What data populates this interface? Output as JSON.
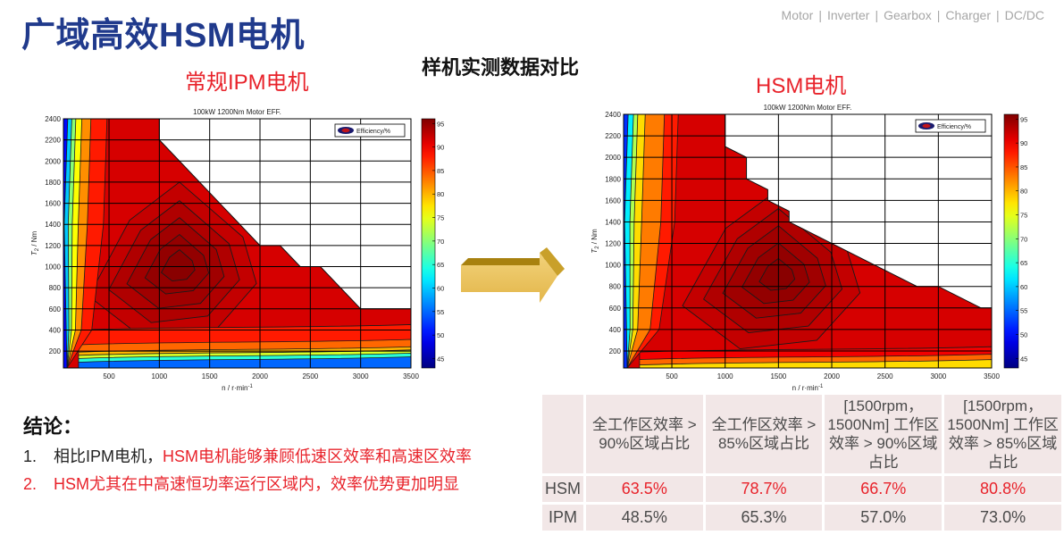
{
  "header": {
    "title": "广域高效HSM电机",
    "nav": [
      "Motor",
      "Inverter",
      "Gearbox",
      "Charger",
      "DC/DC"
    ],
    "nav_separator": "|"
  },
  "subtitle": "样机实测数据对比",
  "labels": {
    "ipm": "常规IPM电机",
    "hsm": "HSM电机"
  },
  "arrow_icon": "right-arrow-icon",
  "chart_data": [
    {
      "id": "ipm",
      "type": "heatmap",
      "title": "100kW 1200Nm Motor EFF.",
      "xlabel": "n / r·min",
      "xlabel_sup": "-1",
      "ylabel": "T",
      "ylabel_sub": "2",
      "ylabel_rest": " / Nm",
      "xlim": [
        47,
        3500
      ],
      "ylim": [
        40,
        2400
      ],
      "xticks": [
        500,
        1000,
        1500,
        2000,
        2500,
        3000,
        3500
      ],
      "yticks": [
        200,
        400,
        600,
        800,
        1000,
        1200,
        1400,
        1600,
        1800,
        2000,
        2200,
        2400
      ],
      "grid": true,
      "legend": {
        "label": "Efficiency/%",
        "position": "top-right"
      },
      "colorbar": {
        "range": [
          43,
          96
        ],
        "ticks": [
          45,
          50,
          55,
          60,
          65,
          70,
          75,
          80,
          85,
          90,
          95
        ],
        "colormap": "jet"
      },
      "torque_envelope": [
        [
          47,
          2400
        ],
        [
          1000,
          2400
        ],
        [
          1000,
          2200
        ],
        [
          2000,
          1200
        ],
        [
          2200,
          1200
        ],
        [
          2400,
          1000
        ],
        [
          2600,
          1000
        ],
        [
          3000,
          600
        ],
        [
          3500,
          600
        ]
      ],
      "peak_region": {
        "center_rpm": 1200,
        "center_nm": 1000,
        "efficiency": 95
      },
      "bands_low_torque": [
        {
          "nm_top": 400,
          "efficiency": 88
        },
        {
          "nm_top": 260,
          "efficiency": 84
        },
        {
          "nm_top": 190,
          "efficiency": 80
        },
        {
          "nm_top": 160,
          "efficiency": 74
        },
        {
          "nm_top": 130,
          "efficiency": 65
        },
        {
          "nm_top": 95,
          "efficiency": 55
        }
      ],
      "bands_low_speed": [
        {
          "rpm_right": 90,
          "efficiency": 50
        },
        {
          "rpm_right": 130,
          "efficiency": 60
        },
        {
          "rpm_right": 170,
          "efficiency": 70
        },
        {
          "rpm_right": 230,
          "efficiency": 76
        },
        {
          "rpm_right": 320,
          "efficiency": 82
        },
        {
          "rpm_right": 480,
          "efficiency": 88
        }
      ]
    },
    {
      "id": "hsm",
      "type": "heatmap",
      "title": "100kW 1200Nm Motor EFF.",
      "xlabel": "n / r·min",
      "xlabel_sup": "-1",
      "ylabel": "T",
      "ylabel_sub": "2",
      "ylabel_rest": " / Nm",
      "xlim": [
        47,
        3500
      ],
      "ylim": [
        42,
        2400
      ],
      "xticks": [
        500,
        1000,
        1500,
        2000,
        2500,
        3000,
        3500
      ],
      "yticks": [
        200,
        400,
        600,
        800,
        1000,
        1200,
        1400,
        1600,
        1800,
        2000,
        2200,
        2400
      ],
      "grid": true,
      "legend": {
        "label": "Efficiency/%",
        "position": "top-right"
      },
      "colorbar": {
        "range": [
          43,
          96
        ],
        "ticks": [
          45,
          50,
          55,
          60,
          65,
          70,
          75,
          80,
          85,
          90,
          95
        ],
        "colormap": "jet"
      },
      "torque_envelope": [
        [
          47,
          2400
        ],
        [
          1000,
          2400
        ],
        [
          1000,
          2100
        ],
        [
          1200,
          2000
        ],
        [
          1200,
          1800
        ],
        [
          1400,
          1700
        ],
        [
          1400,
          1600
        ],
        [
          1600,
          1500
        ],
        [
          1600,
          1400
        ],
        [
          2800,
          800
        ],
        [
          3000,
          800
        ],
        [
          3400,
          600
        ],
        [
          3500,
          600
        ]
      ],
      "peak_region": {
        "center_rpm": 1500,
        "center_nm": 900,
        "efficiency": 95
      },
      "bands_low_torque": [
        {
          "nm_top": 190,
          "efficiency": 90
        },
        {
          "nm_top": 120,
          "efficiency": 84
        },
        {
          "nm_top": 70,
          "efficiency": 78
        }
      ],
      "bands_low_speed": [
        {
          "rpm_right": 90,
          "efficiency": 52
        },
        {
          "rpm_right": 140,
          "efficiency": 62
        },
        {
          "rpm_right": 180,
          "efficiency": 72
        },
        {
          "rpm_right": 250,
          "efficiency": 78
        },
        {
          "rpm_right": 430,
          "efficiency": 83
        },
        {
          "rpm_right": 560,
          "efficiency": 88
        }
      ]
    }
  ],
  "conclusion": {
    "title": "结论：",
    "items": [
      {
        "num": "1.",
        "plain": "相比IPM电机，",
        "highlight": "HSM电机能够兼顾低速区效率和高速区效率"
      },
      {
        "num": "2.",
        "plain": "",
        "highlight": "HSM尤其在中高速恒功率运行区域内，效率优势更加明显"
      }
    ]
  },
  "table": {
    "headers": [
      "",
      "全工作区效率 > 90%区域占比",
      "全工作区效率 > 85%区域占比",
      "[1500rpm， 1500Nm] 工作区效率 > 90%区域占比",
      "[1500rpm， 1500Nm] 工作区效率 > 85%区域占比"
    ],
    "rows": [
      {
        "name": "HSM",
        "values": [
          "63.5%",
          "78.7%",
          "66.7%",
          "80.8%"
        ]
      },
      {
        "name": "IPM",
        "values": [
          "48.5%",
          "65.3%",
          "57.0%",
          "73.0%"
        ]
      }
    ]
  },
  "colors": {
    "title": "#203a8c",
    "accent_red": "#e8222a",
    "nav_gray": "#a6a6a6",
    "table_bg": "#f2e7e7"
  }
}
